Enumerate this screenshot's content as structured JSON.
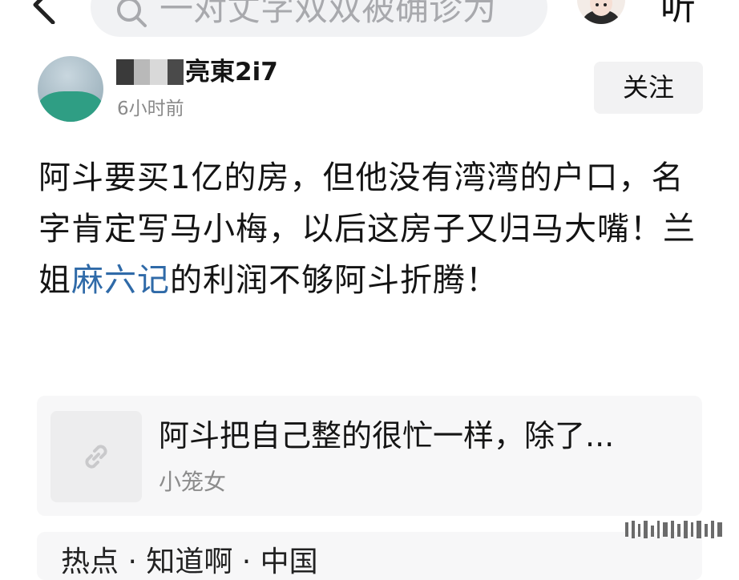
{
  "header": {
    "search_placeholder": "一对丈字双双被确诊为",
    "listen_label": "听"
  },
  "post": {
    "author_name": "亮東2i7",
    "time": "6小时前",
    "follow_label": "关注",
    "text_before_link": "阿斗要买1亿的房，但他没有湾湾的户口，名字肯定写马小梅，以后这房子又归马大嘴！兰姐",
    "link_text": "麻六记",
    "text_after_link": "的利润不够阿斗折腾！"
  },
  "linked_article": {
    "title": "阿斗把自己整的很忙一样，除了...",
    "source": "小笼女"
  },
  "next_card": {
    "partial_text": "热点    ·  知道啊  · 中国"
  },
  "colors": {
    "link": "#2f6aa8",
    "follow_bg": "#f2f2f3",
    "card_bg": "#f7f7f8",
    "search_bg": "#f1f2f4",
    "avatar_green": "#2f9e84"
  }
}
